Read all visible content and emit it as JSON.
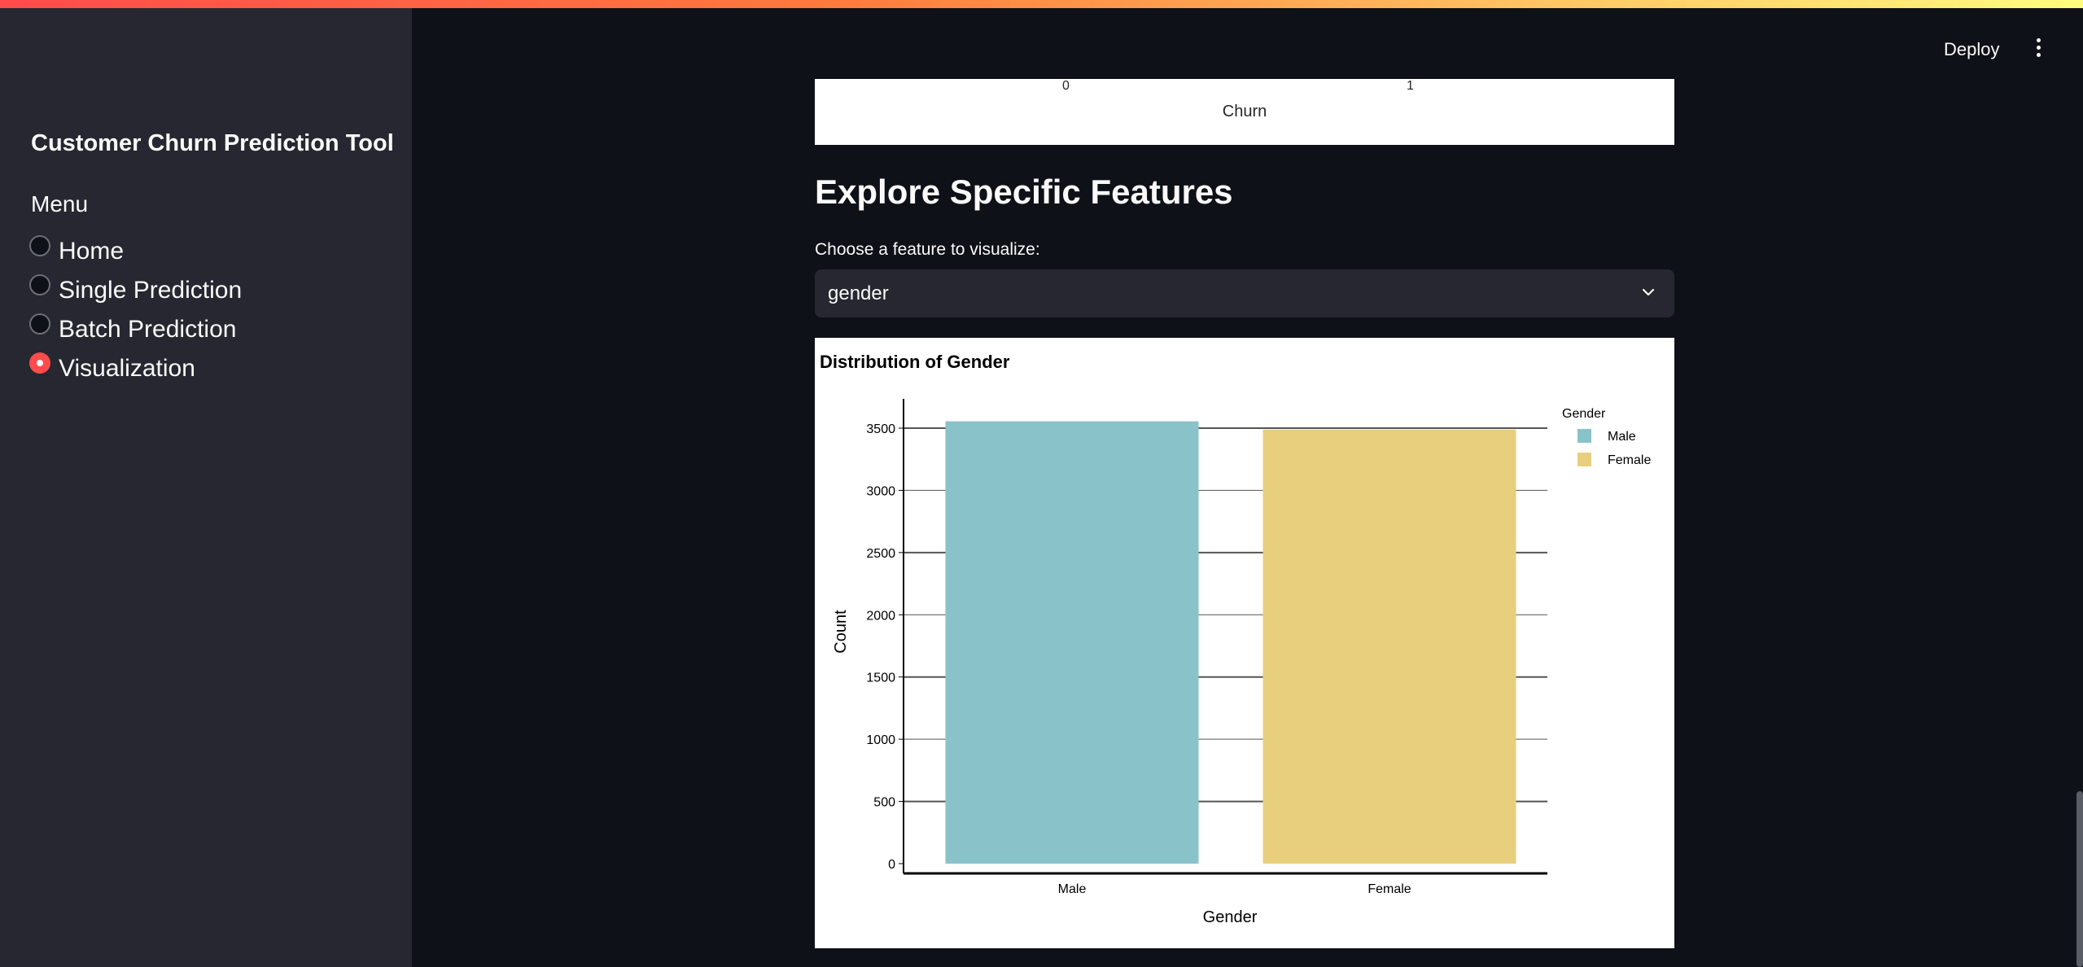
{
  "sidebar": {
    "app_title": "Customer Churn Prediction Tool",
    "menu_label": "Menu",
    "items": [
      {
        "label": "Home",
        "selected": false
      },
      {
        "label": "Single Prediction",
        "selected": false
      },
      {
        "label": "Batch Prediction",
        "selected": false
      },
      {
        "label": "Visualization",
        "selected": true
      }
    ]
  },
  "header": {
    "deploy_label": "Deploy",
    "menu_icon": "more-vertical-icon"
  },
  "previous_chart": {
    "ticks": [
      "0",
      "1"
    ],
    "xlabel": "Churn"
  },
  "main": {
    "section_title": "Explore Specific Features",
    "select_label": "Choose a feature to visualize:",
    "select_value": "gender",
    "select_icon": "chevron-down-icon"
  },
  "colors": {
    "accent": "#ff4b4b",
    "male": "#89c2c9",
    "female": "#e8cf7e"
  },
  "chart_data": {
    "type": "bar",
    "title": "Distribution of Gender",
    "xlabel": "Gender",
    "ylabel": "Count",
    "categories": [
      "Male",
      "Female"
    ],
    "values": [
      3555,
      3488
    ],
    "ylim": [
      0,
      3700
    ],
    "yticks": [
      0,
      500,
      1000,
      1500,
      2000,
      2500,
      3000,
      3500
    ],
    "grid": true,
    "legend": {
      "title": "Gender",
      "placement": "top-right",
      "entries": [
        "Male",
        "Female"
      ]
    }
  }
}
